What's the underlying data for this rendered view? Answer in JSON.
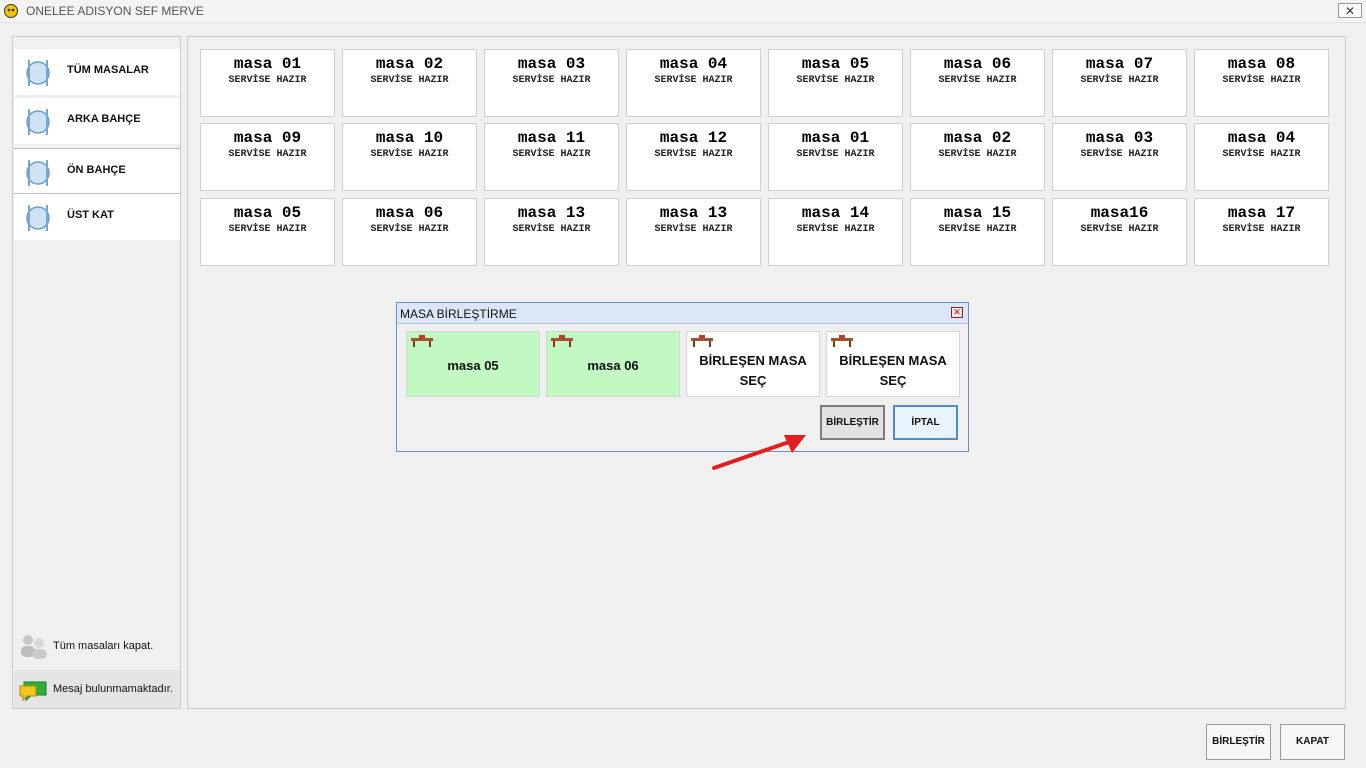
{
  "window": {
    "title": "ONELEE ADISYON SEF MERVE",
    "close_label": "✕"
  },
  "sidebar": {
    "items": [
      {
        "label": "TÜM MASALAR"
      },
      {
        "label": "ARKA BAHÇE"
      },
      {
        "label": "ÖN BAHÇE"
      },
      {
        "label": "ÜST KAT"
      }
    ],
    "close_all_label": "Tüm masaları kapat.",
    "message_label": "Mesaj bulunmamaktadır."
  },
  "tables": [
    {
      "name": "masa 01",
      "status": "SERVİSE HAZIR"
    },
    {
      "name": "masa 02",
      "status": "SERVİSE HAZIR"
    },
    {
      "name": "masa 03",
      "status": "SERVİSE HAZIR"
    },
    {
      "name": "masa 04",
      "status": "SERVİSE HAZIR"
    },
    {
      "name": "masa 05",
      "status": "SERVİSE HAZIR"
    },
    {
      "name": "masa 06",
      "status": "SERVİSE HAZIR"
    },
    {
      "name": "masa 07",
      "status": "SERVİSE HAZIR"
    },
    {
      "name": "masa 08",
      "status": "SERVİSE HAZIR"
    },
    {
      "name": "masa 09",
      "status": "SERVİSE HAZIR"
    },
    {
      "name": "masa 10",
      "status": "SERVİSE HAZIR"
    },
    {
      "name": "masa 11",
      "status": "SERVİSE HAZIR"
    },
    {
      "name": "masa 12",
      "status": "SERVİSE HAZIR"
    },
    {
      "name": "masa 01",
      "status": "SERVİSE HAZIR"
    },
    {
      "name": "masa 02",
      "status": "SERVİSE HAZIR"
    },
    {
      "name": "masa 03",
      "status": "SERVİSE HAZIR"
    },
    {
      "name": "masa 04",
      "status": "SERVİSE HAZIR"
    },
    {
      "name": "masa 05",
      "status": "SERVİSE HAZIR"
    },
    {
      "name": "masa 06",
      "status": "SERVİSE HAZIR"
    },
    {
      "name": "masa 13",
      "status": "SERVİSE HAZIR"
    },
    {
      "name": "masa 13",
      "status": "SERVİSE HAZIR"
    },
    {
      "name": "masa 14",
      "status": "SERVİSE HAZIR"
    },
    {
      "name": "masa 15",
      "status": "SERVİSE HAZIR"
    },
    {
      "name": "masa16",
      "status": "SERVİSE HAZIR"
    },
    {
      "name": "masa 17",
      "status": "SERVİSE HAZIR"
    }
  ],
  "dialog": {
    "title": "MASA BİRLEŞTİRME",
    "close_label": "✕",
    "cards": [
      {
        "line1": "masa 05",
        "line2": ""
      },
      {
        "line1": "masa 06",
        "line2": ""
      },
      {
        "line1": "BİRLEŞEN MASA",
        "line2": "SEÇ"
      },
      {
        "line1": "BİRLEŞEN MASA",
        "line2": "SEÇ"
      }
    ],
    "merge_button": "BİRLEŞTİR",
    "cancel_button": "İPTAL"
  },
  "footer": {
    "merge_button": "BİRLEŞTİR",
    "close_button": "KAPAT"
  },
  "colors": {
    "selected_card": "#c2f9c2",
    "dialog_title_bg": "#dbe7f6",
    "arrow": "#e02020"
  }
}
